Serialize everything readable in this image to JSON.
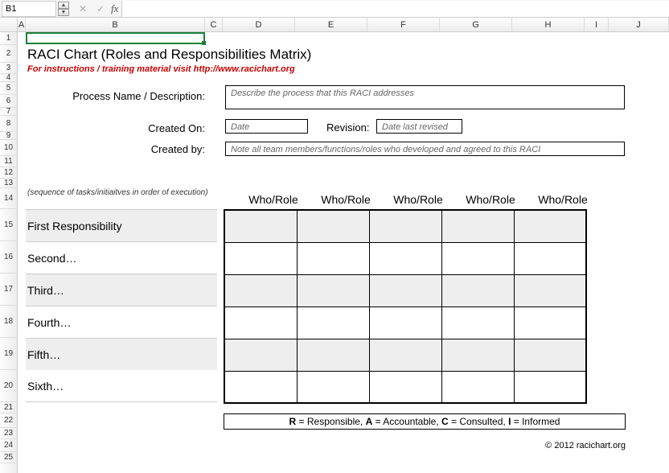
{
  "formula_bar": {
    "cell_ref": "B1",
    "fx": "fx"
  },
  "columns": [
    "A",
    "B",
    "C",
    "D",
    "E",
    "F",
    "G",
    "H",
    "I",
    "J"
  ],
  "row_numbers": [
    "1",
    "2",
    "3",
    "4",
    "5",
    "6",
    "7",
    "8",
    "9",
    "10",
    "11",
    "12",
    "13",
    "14",
    "15",
    "16",
    "17",
    "18",
    "19",
    "20",
    "21",
    "22",
    "23",
    "24",
    "25"
  ],
  "title": "RACI Chart (Roles and Responsibilities Matrix)",
  "instructions": "For instructions / training material visit http://www.racichart.org",
  "labels": {
    "process": "Process Name / Description:",
    "created_on": "Created On:",
    "revision": "Revision:",
    "created_by": "Created by:"
  },
  "placeholders": {
    "process": "Describe the process that this RACI addresses",
    "date": "Date",
    "date_revised": "Date last revised",
    "created_by": "Note all team members/functions/roles who developed and agreed to this RACI"
  },
  "seq_note": "(sequence of tasks/initiaitves in order of execution)",
  "role_headers": [
    "Who/Role",
    "Who/Role",
    "Who/Role",
    "Who/Role",
    "Who/Role"
  ],
  "responsibilities": [
    "First Responsibility",
    "Second…",
    "Third…",
    "Fourth…",
    "Fifth…",
    "Sixth…"
  ],
  "legend": {
    "r": "R",
    "r_txt": " = Responsible,   ",
    "a": "A",
    "a_txt": " = Accountable,   ",
    "c": "C",
    "c_txt": " = Consulted,   ",
    "i": "I",
    "i_txt": " = Informed"
  },
  "copyright": "© 2012 racichart.org"
}
